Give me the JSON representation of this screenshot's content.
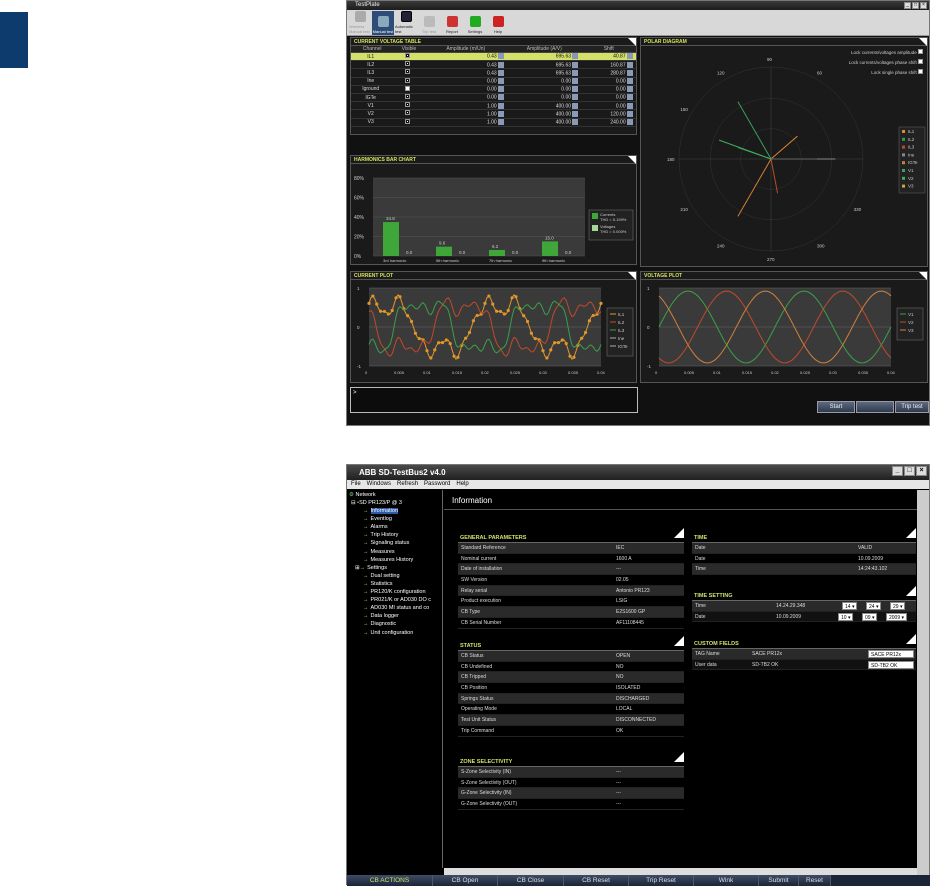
{
  "w1": {
    "title": "TestPlate",
    "toolbar": [
      "Wireless Manual test",
      "Manual test",
      "Automatic test",
      "Trip test",
      "Report",
      "Settings",
      "Help"
    ],
    "voltage": {
      "title": "CURRENT VOLTAGE TABLE",
      "headers": [
        "Channel",
        "Visible",
        "Amplitude (m/Un)",
        "Amplitude (A/V)",
        "Shift"
      ],
      "rows": [
        {
          "ch": "IL1",
          "amp": "0.43",
          "aa": "695.63",
          "shift": "40.87"
        },
        {
          "ch": "IL2",
          "amp": "0.43",
          "aa": "695.63",
          "shift": "160.87"
        },
        {
          "ch": "IL3",
          "amp": "0.43",
          "aa": "695.63",
          "shift": "280.87"
        },
        {
          "ch": "Ine",
          "amp": "0.00",
          "aa": "0.00",
          "shift": "0.00"
        },
        {
          "ch": "Iground",
          "amp": "0.00",
          "aa": "0.00",
          "shift": "0.00"
        },
        {
          "ch": "IGTe",
          "amp": "0.00",
          "aa": "0.00",
          "shift": "0.00"
        },
        {
          "ch": "V1",
          "amp": "1.00",
          "aa": "400.00",
          "shift": "0.00"
        },
        {
          "ch": "V2",
          "amp": "1.00",
          "aa": "400.00",
          "shift": "120.00"
        },
        {
          "ch": "V3",
          "amp": "1.00",
          "aa": "400.00",
          "shift": "240.00"
        }
      ]
    },
    "polar": {
      "title": "POLAR DIAGRAM",
      "locks": [
        "Lock currents/voltages amplitude",
        "Lock currents/voltages phase shift",
        "Lock single phase shift"
      ],
      "angles": [
        "90",
        "120",
        "60",
        "150",
        "180",
        "210",
        "240",
        "270",
        "300",
        "330"
      ],
      "legend": [
        "IL1",
        "IL2",
        "IL3",
        "Ine",
        "IGTe",
        "V1",
        "V2",
        "V3"
      ]
    },
    "harm": {
      "title": "HARMONICS BAR CHART",
      "legend": [
        "Currents",
        "THD = 5.159%",
        "Voltages",
        "THD = 0.000%"
      ]
    },
    "cplot": {
      "title": "CURRENT PLOT",
      "legend": [
        "IL1",
        "IL2",
        "IL3",
        "Ine",
        "IGTe"
      ]
    },
    "vplot": {
      "title": "VOLTAGE PLOT",
      "legend": [
        "V1",
        "V2",
        "V3"
      ]
    },
    "log": ">",
    "buttons": [
      "Start",
      "",
      "Trip test"
    ]
  },
  "chart_data": [
    {
      "type": "bar",
      "title": "HARMONICS BAR CHART",
      "categories": [
        "3rd harmonic",
        "5th harmonic",
        "7th harmonic",
        "9th harmonic"
      ],
      "series": [
        {
          "name": "Currents",
          "values": [
            34.8,
            9.6,
            6.2,
            15.0
          ]
        },
        {
          "name": "Voltages",
          "values": [
            0.0,
            0.0,
            0.0,
            0.0
          ]
        }
      ],
      "ylim": [
        0,
        80
      ],
      "yticks": [
        "0%",
        "20%",
        "40%",
        "60%",
        "80%"
      ]
    },
    {
      "type": "line",
      "title": "CURRENT PLOT",
      "ylim": [
        -1,
        1
      ],
      "yticks": [
        "-1",
        "0",
        "1"
      ],
      "xticks": [
        "0",
        "0.005",
        "0.01",
        "0.015",
        "0.02",
        "0.025",
        "0.03",
        "0.035",
        "0.04"
      ]
    },
    {
      "type": "line",
      "title": "VOLTAGE PLOT",
      "ylim": [
        -1,
        1
      ],
      "yticks": [
        "-1",
        "0",
        "1"
      ],
      "xticks": [
        "0",
        "0.005",
        "0.01",
        "0.015",
        "0.02",
        "0.025",
        "0.03",
        "0.035",
        "0.04"
      ]
    }
  ],
  "w2": {
    "title": "ABB SD-TestBus2 v4.0",
    "menu": [
      "File",
      "Windows",
      "Refresh",
      "Password",
      "Help"
    ],
    "tree": {
      "root": "Network",
      "device": "SD PR123/P @ 3",
      "items": [
        "Information",
        "Eventlog",
        "Alarms",
        "Trip History",
        "Signaling status",
        "Measures",
        "Measures History",
        "Settings",
        "Dual setting",
        "Statistics",
        "PR120/K configuration",
        "PR021/K or AD030 DO c",
        "AD030 MI status and co",
        "Data logger",
        "Diagnostic",
        "Unit configuration"
      ]
    },
    "page_title": "Information",
    "general": {
      "title": "GENERAL PARAMETERS",
      "rows": [
        [
          "Standard Reference",
          "IEC"
        ],
        [
          "Nominal current",
          "1600 A"
        ],
        [
          "Date of installation",
          "---"
        ],
        [
          "SW Version",
          "02.05"
        ],
        [
          "Relay serial",
          "Antonio PR123"
        ],
        [
          "Product execution",
          "LSIG"
        ],
        [
          "CB Type",
          "E2S1600 GP"
        ],
        [
          "CB Serial Number",
          "AF11108445"
        ]
      ]
    },
    "status": {
      "title": "STATUS",
      "rows": [
        [
          "CB Status",
          "OPEN"
        ],
        [
          "CB Undefined",
          "NO"
        ],
        [
          "CB Tripped",
          "NO"
        ],
        [
          "CB Position",
          "ISOLATED"
        ],
        [
          "Springs Status",
          "DISCHARGED"
        ],
        [
          "Operating Mode",
          "LOCAL"
        ],
        [
          "Test Unit Status",
          "DISCONNECTED"
        ],
        [
          "Trip Command",
          "OK"
        ]
      ]
    },
    "zone": {
      "title": "ZONE SELECTIVITY",
      "rows": [
        [
          "S-Zone Selectivity (IN)",
          "---"
        ],
        [
          "S-Zone Selectivity (OUT)",
          "---"
        ],
        [
          "G-Zone Selectivity (IN)",
          "---"
        ],
        [
          "G-Zone Selectivity (OUT)",
          "---"
        ]
      ]
    },
    "time": {
      "title": "TIME",
      "rows": [
        [
          "Date",
          "VALID"
        ],
        [
          "Date",
          "10.09.2009"
        ],
        [
          "Time",
          "14:24:43.102"
        ]
      ]
    },
    "timeset": {
      "title": "TIME SETTING",
      "time_label": "Time",
      "time_val": "14.24.29.348",
      "h": "14",
      "m": "24",
      "s": "29",
      "date_label": "Date",
      "date_val": "10.09.2009",
      "d": "10",
      "mo": "09",
      "y": "2009"
    },
    "custom": {
      "title": "CUSTOM FIELDS",
      "rows": [
        [
          "TAG Name",
          "SACE PR12x",
          "SACE PR12x"
        ],
        [
          "User data",
          "SD-TB2 OK",
          "SD-TB2 OK"
        ]
      ]
    },
    "buttons": [
      "CB ACTIONS",
      "CB Open",
      "CB Close",
      "CB Reset",
      "Trip Reset",
      "Wink",
      "Submit",
      "Reset"
    ]
  }
}
